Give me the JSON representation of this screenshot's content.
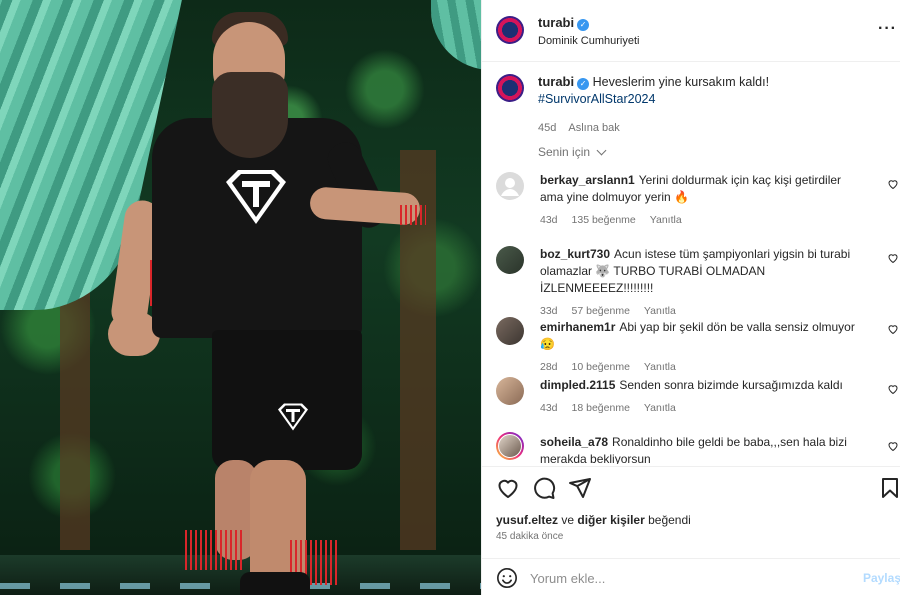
{
  "post": {
    "username": "turabi",
    "location": "Dominik Cumhuriyeti",
    "more_icon": "more-horizontal-icon",
    "caption_text": "Heveslerim yine kursakım kaldı!",
    "caption_hashtag": "#SurvivorAllStar2024",
    "caption_time": "45d",
    "translate_label": "Aslına bak",
    "sort_label": "Senin için"
  },
  "comments": [
    {
      "username": "berkay_arslann1",
      "text": "Yerini doldurmak için kaç kişi getirdiler ama yine dolmuyor yerin 🔥",
      "time": "43d",
      "likes": "135 beğenme",
      "reply": "Yanıtla"
    },
    {
      "username": "boz_kurt730",
      "text": "Acun istese tüm şampiyonlari yigsin bi turabi olamazlar 🐺 TURBO TURABİ OLMADAN İZLENMEEEEZ!!!!!!!!!",
      "time": "33d",
      "likes": "57 beğenme",
      "reply": "Yanıtla"
    },
    {
      "username": "emirhanem1r",
      "text": "Abi yap bir şekil dön be valla sensiz olmuyor😥",
      "time": "28d",
      "likes": "10 beğenme",
      "reply": "Yanıtla"
    },
    {
      "username": "dimpled.2115",
      "text": "Senden sonra bizimde kursağımızda kaldı",
      "time": "43d",
      "likes": "18 beğenme",
      "reply": "Yanıtla"
    },
    {
      "username": "soheila_a78",
      "text": "Ronaldinho bile geldi be baba,,,sen hala bizi merakda bekliyorsun",
      "time": "",
      "likes": "",
      "reply": ""
    }
  ],
  "actions": {
    "like_icon": "heart-icon",
    "comment_icon": "comment-icon",
    "share_icon": "send-icon",
    "save_icon": "bookmark-icon"
  },
  "liked_by": {
    "user": "yusuf.eltez",
    "connector": "ve",
    "others": "diğer kişiler",
    "suffix": "beğendi"
  },
  "posted_ago": "45 dakika önce",
  "compose": {
    "emoji_icon": "emoji-icon",
    "placeholder": "Yorum ekle...",
    "post_label": "Paylaş"
  },
  "colors": {
    "verified": "#3897f0",
    "hashtag": "#00376b",
    "muted": "#737373",
    "post_disabled": "#b3dbff"
  }
}
